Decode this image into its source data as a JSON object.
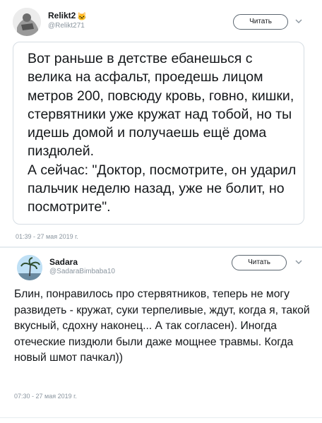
{
  "tweets": [
    {
      "name": "Relikt2",
      "badge": "🐱",
      "handle": "@Relikt271",
      "follow_label": "Читать",
      "text": "Вот раньше в детстве ебанешься с велика на асфальт, проедешь лицом метров 200, повсюду кровь, говно, кишки, стервятники уже кружат над тобой, но ты идешь домой и получаешь ещё дома пиздюлей.\nА сейчас: \"Доктор, посмотрите, он ударил пальчик неделю назад, уже не болит, но посмотрите\".",
      "timestamp": "01:39 - 27 мая 2019 г."
    },
    {
      "name": "Sadara",
      "handle": "@SadaraBimbaba10",
      "follow_label": "Читать",
      "text": "Блин, понравилось про стервятников, теперь не могу развидеть - кружат, суки терпеливые, ждут, когда я, такой вкусный, сдохну наконец... А так согласен). Иногда отечeские пиздюли были даже мощнее травмы. Когда новый шмот пачкал))",
      "timestamp": "07:30 - 27 мая 2019 г."
    }
  ],
  "icons": {
    "chevron": "chevron-down-icon",
    "avatar1": "avatar-grayscale-illustration",
    "avatar2": "avatar-palm-tree-sky"
  },
  "colors": {
    "text": "#14171a",
    "muted": "#8a959f",
    "border": "#d6dde3"
  }
}
